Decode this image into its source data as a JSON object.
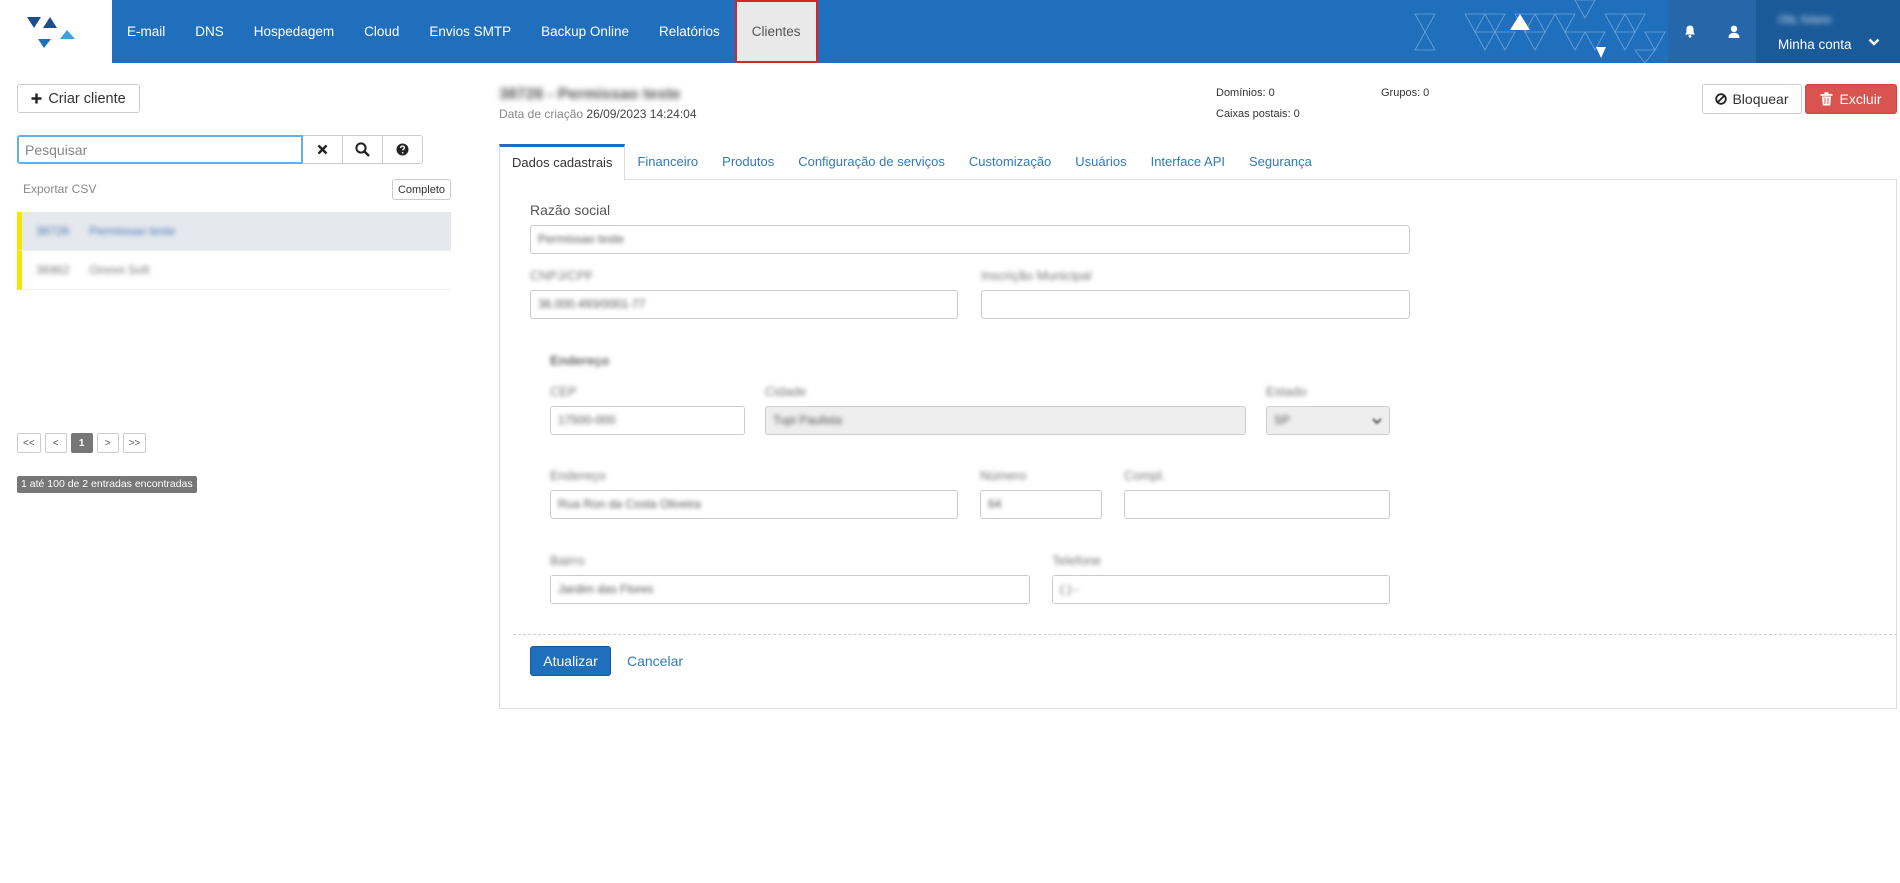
{
  "nav": {
    "items": [
      {
        "label": "E-mail"
      },
      {
        "label": "DNS"
      },
      {
        "label": "Hospedagem"
      },
      {
        "label": "Cloud"
      },
      {
        "label": "Envios SMTP"
      },
      {
        "label": "Backup Online"
      },
      {
        "label": "Relatórios"
      },
      {
        "label": "Clientes",
        "active": true
      }
    ],
    "account_user": "Olá, fulano",
    "account_label": "Minha conta",
    "bell_icon": "bell-icon",
    "user_icon": "user-icon"
  },
  "sidebar": {
    "create_label": "Criar cliente",
    "search_placeholder": "Pesquisar",
    "export_label": "Exportar CSV",
    "completo_label": "Completo",
    "clients": [
      {
        "id": "38726",
        "name": "Permissao teste",
        "selected": true
      },
      {
        "id": "36962",
        "name": "Omnni Soft",
        "selected": false
      }
    ],
    "pager": [
      "<<",
      "<",
      "1",
      ">",
      ">>"
    ],
    "current_page": "1",
    "entries": "1 até 100 de 2 entradas encontradas"
  },
  "client": {
    "title": "38726 - Permissao teste",
    "created_label": "Data de criação",
    "created_value": "26/09/2023 14:24:04",
    "dominios": "Domínios: 0",
    "caixas": "Caixas postais: 0",
    "grupos": "Grupos: 0",
    "block_label": "Bloquear",
    "delete_label": "Excluir"
  },
  "tabs": [
    {
      "label": "Dados cadastrais",
      "active": true
    },
    {
      "label": "Financeiro"
    },
    {
      "label": "Produtos"
    },
    {
      "label": "Configuração de serviços"
    },
    {
      "label": "Customização"
    },
    {
      "label": "Usuários"
    },
    {
      "label": "Interface API"
    },
    {
      "label": "Segurança"
    }
  ],
  "form": {
    "razao_label": "Razão social",
    "razao_value": "Permissao teste",
    "cnpj_label": "CNPJ/CPF",
    "cnpj_value": "36.000.493/0001-77",
    "inscricao_label": "Inscrição Municipal",
    "inscricao_value": "",
    "endereco_title": "Endereço",
    "cep_label": "CEP",
    "cep_value": "17500-000",
    "cidade_label": "Cidade",
    "cidade_value": "Tupi Paulista",
    "estado_label": "Estado",
    "estado_value": "SP",
    "endereco_label": "Endereço",
    "endereco_value": "Rua Ron da Costa Oliveira",
    "numero_label": "Número",
    "numero_value": "64",
    "compl_label": "Compl.",
    "compl_value": "",
    "bairro_label": "Bairro",
    "bairro_value": "Jardim das Flores",
    "telefone_label": "Telefone",
    "telefone_value": "( )   -",
    "update_label": "Atualizar",
    "cancel_label": "Cancelar"
  }
}
